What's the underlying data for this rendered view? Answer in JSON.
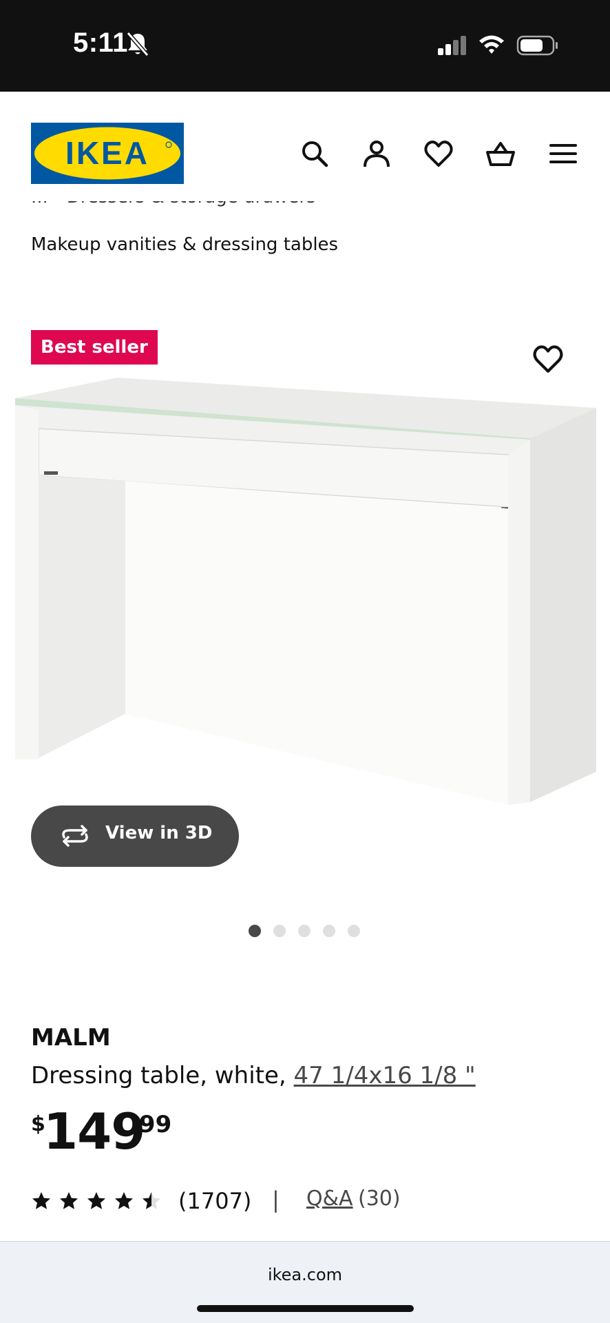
{
  "status_bar": {
    "time": "5:11",
    "icons": [
      "bell-slash-icon",
      "signal-icon",
      "wifi-icon",
      "battery-icon"
    ]
  },
  "header": {
    "logo_text": "IKEA",
    "logo_colors": {
      "blue": "#0058a3",
      "yellow": "#ffdb00"
    },
    "icons": [
      "search-icon",
      "account-icon",
      "heart-icon",
      "basket-icon",
      "menu-icon"
    ]
  },
  "breadcrumb": {
    "partial": "...  ›  Dressers & storage drawers  ›",
    "current": "Makeup vanities & dressing tables"
  },
  "product": {
    "badge": "Best seller",
    "badge_color": "#e00751",
    "view_3d_label": "View in 3D",
    "carousel": {
      "count": 5,
      "active_index": 0
    },
    "name": "MALM",
    "description": "Dressing table, white, ",
    "size_link": "47 1/4x16 1/8 \"",
    "price": {
      "currency": "$",
      "integer": "149",
      "decimal": ".99"
    },
    "rating": {
      "value": 4.5,
      "max": 5,
      "count_text": "(1707)"
    },
    "separator": "|",
    "qa_label": "Q&A",
    "qa_count": "(30)"
  },
  "browser": {
    "url": "ikea.com"
  }
}
